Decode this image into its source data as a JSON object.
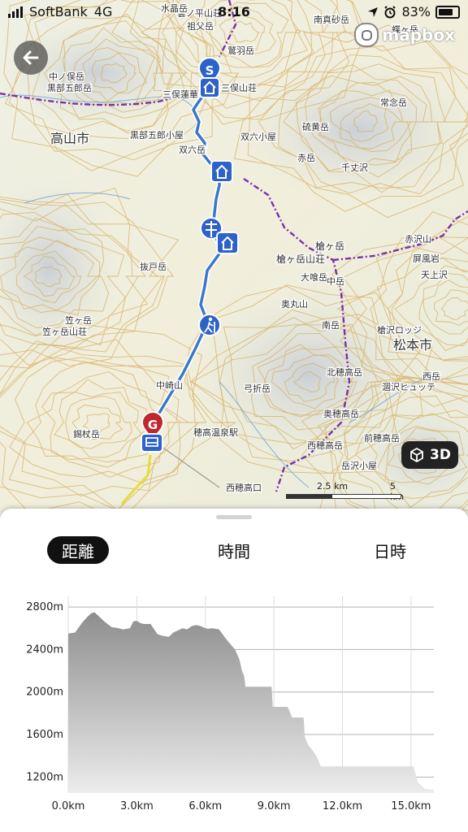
{
  "status_bar": {
    "carrier": "SoftBank",
    "network": "4G",
    "time": "8:16",
    "battery": "83%"
  },
  "map": {
    "attribution": "mapbox",
    "view_3d_label": "3D",
    "scale_labels": [
      "2.5 km",
      "5 km"
    ],
    "place_labels": [
      "高山市",
      "松本市",
      "槍ヶ岳",
      "槍ヶ岳山荘",
      "双六小屋",
      "笠ヶ岳山荘",
      "笠ヶ岳",
      "抜戸岳",
      "中崎山",
      "錫杖岳",
      "奥丸山",
      "南岳",
      "北穂高岳",
      "奥穂高岳",
      "前穂高岳",
      "西穂高岳",
      "岳沢小屋",
      "槍沢ロッジ",
      "涸沢ヒュッテ",
      "赤沢山",
      "三俣蓮華",
      "黒部五郎小屋",
      "鷲羽岳",
      "硫黄岳",
      "赤岳",
      "雲ノ平山荘",
      "祖父岳",
      "南真砂岳",
      "蝶ヶ岳",
      "常念岳",
      "水晶岳",
      "穂高温泉駅",
      "西穂高口",
      "中ノ俣岳",
      "黒部五郎岳",
      "大喰岳",
      "中岳",
      "屏風岩",
      "西岳",
      "天上沢",
      "千丈沢",
      "双六岳",
      "三俣山荘",
      "弓折岳"
    ],
    "markers": {
      "start": "S",
      "goal": "G"
    },
    "colors": {
      "route": "#3a78c8",
      "pin_start": "#2d62c9",
      "pin_goal": "#c0262d"
    }
  },
  "tabs": [
    {
      "label": "距離",
      "active": true
    },
    {
      "label": "時間",
      "active": false
    },
    {
      "label": "日時",
      "active": false
    }
  ],
  "chart_data": {
    "type": "area",
    "title": "",
    "xlabel": "",
    "ylabel": "",
    "xlim": [
      0,
      16.0
    ],
    "ylim": [
      1050,
      2900
    ],
    "x_ticks": [
      0,
      3,
      6,
      9,
      12,
      15
    ],
    "x_tick_labels": [
      "0.0km",
      "3.0km",
      "6.0km",
      "9.0km",
      "12.0km",
      "15.0km"
    ],
    "y_ticks": [
      1200,
      1600,
      2000,
      2400,
      2800
    ],
    "y_tick_labels": [
      "1200m",
      "1600m",
      "2000m",
      "2400m",
      "2800m"
    ],
    "grid": true,
    "series": [
      {
        "x": [
          0,
          0.3,
          0.6,
          0.8,
          1.0,
          1.15,
          1.3,
          1.6,
          1.9,
          2.1,
          2.4,
          2.7,
          2.85,
          3.0,
          3.15,
          3.3,
          3.6,
          3.9,
          4.1,
          4.4,
          4.6,
          4.8,
          5.0,
          5.2,
          5.4,
          5.6,
          5.8,
          6.0,
          6.1,
          6.3,
          6.6,
          6.9,
          7.1,
          7.3,
          7.5,
          7.6,
          7.7,
          7.75,
          8.0,
          8.5,
          8.9,
          8.95,
          9.2,
          9.6,
          9.8,
          10.3,
          10.35,
          10.5,
          10.7,
          10.9,
          11.05,
          11.5,
          12.5,
          14.0,
          15.1,
          15.3,
          15.6,
          16.0
        ],
        "y": [
          2550,
          2560,
          2650,
          2700,
          2740,
          2750,
          2720,
          2660,
          2610,
          2605,
          2590,
          2600,
          2665,
          2670,
          2650,
          2640,
          2640,
          2545,
          2530,
          2520,
          2560,
          2580,
          2600,
          2590,
          2620,
          2630,
          2620,
          2600,
          2595,
          2600,
          2590,
          2500,
          2450,
          2400,
          2300,
          2200,
          2150,
          2050,
          2050,
          2050,
          2050,
          1860,
          1860,
          1860,
          1760,
          1760,
          1580,
          1500,
          1450,
          1380,
          1300,
          1300,
          1300,
          1300,
          1300,
          1150,
          1090,
          1080
        ]
      }
    ],
    "colors": {
      "fill_top": "#8e8e8e",
      "fill_bottom": "#ececec",
      "grid": "#b0b0b0"
    }
  }
}
